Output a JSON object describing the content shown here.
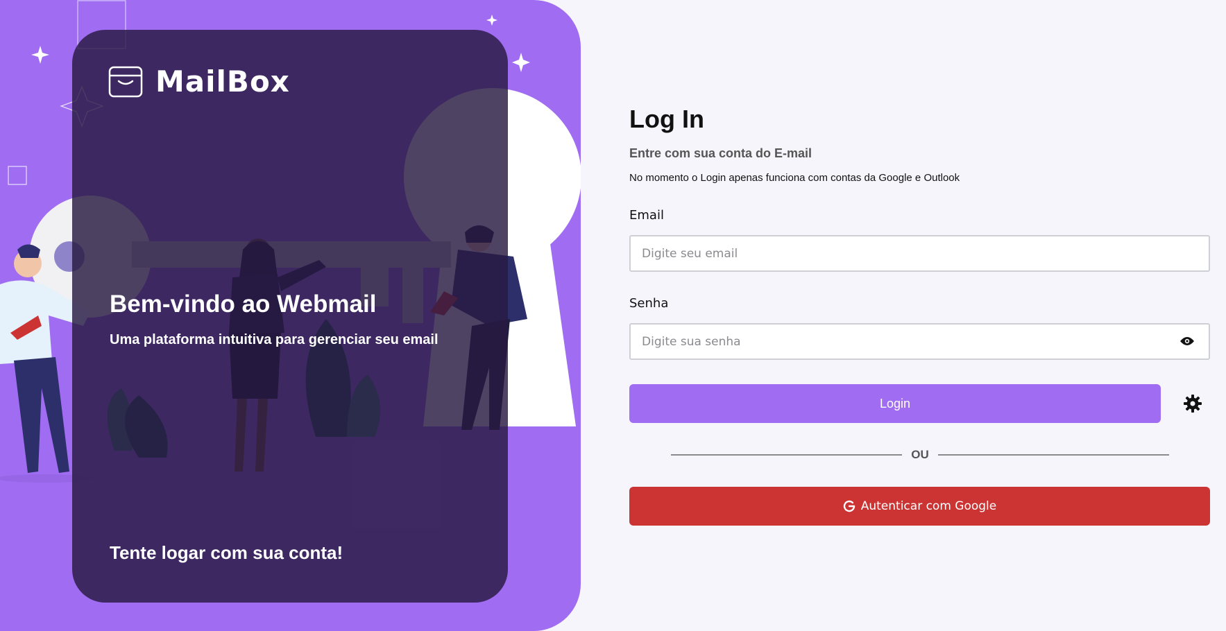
{
  "hero": {
    "logo_text": "MailBox",
    "title": "Bem-vindo ao Webmail",
    "subtitle": "Uma plataforma intuitiva para gerenciar seu email",
    "cta": "Tente logar com sua conta!"
  },
  "form": {
    "title": "Log In",
    "subtitle": "Entre com sua conta do E-mail",
    "note": "No momento o Login apenas funciona com contas da Google e Outlook",
    "email": {
      "label": "Email",
      "placeholder": "Digite seu email",
      "value": ""
    },
    "password": {
      "label": "Senha",
      "placeholder": "Digite sua senha",
      "value": ""
    },
    "login_label": "Login",
    "divider_text": "OU",
    "google_label": "Autenticar com Google"
  },
  "colors": {
    "accent": "#a06cf2",
    "card": "#2d1d4a",
    "google": "#cc3333",
    "background": "#f6f5fb"
  },
  "icons": [
    "mail-icon",
    "eye-icon",
    "gear-icon",
    "google-icon",
    "sparkle-icon"
  ]
}
